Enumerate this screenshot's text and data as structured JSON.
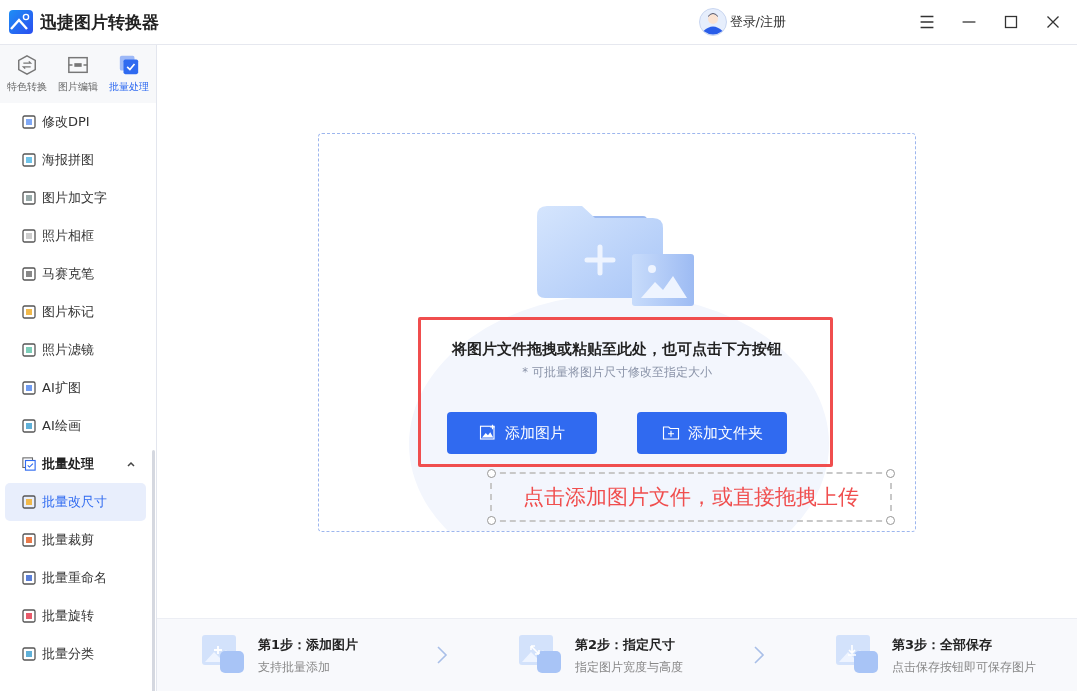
{
  "app": {
    "title": "迅捷图片转换器"
  },
  "user": {
    "label": "登录/注册"
  },
  "sidebar": {
    "tabs": [
      {
        "label": "特色转换",
        "selected": false,
        "kind": "convert"
      },
      {
        "label": "图片编辑",
        "selected": false,
        "kind": "edit"
      },
      {
        "label": "批量处理",
        "selected": true,
        "kind": "batch"
      }
    ],
    "items": [
      {
        "label": "修改DPI",
        "kind": "item",
        "selected": false
      },
      {
        "label": "海报拼图",
        "kind": "item",
        "selected": false
      },
      {
        "label": "图片加文字",
        "kind": "item",
        "selected": false
      },
      {
        "label": "照片相框",
        "kind": "item",
        "selected": false
      },
      {
        "label": "马赛克笔",
        "kind": "item",
        "selected": false
      },
      {
        "label": "图片标记",
        "kind": "item",
        "selected": false
      },
      {
        "label": "照片滤镜",
        "kind": "item",
        "selected": false
      },
      {
        "label": "AI扩图",
        "kind": "item",
        "selected": false
      },
      {
        "label": "AI绘画",
        "kind": "item",
        "selected": false
      },
      {
        "label": "批量处理",
        "kind": "group",
        "expanded": true,
        "children": [
          {
            "label": "批量改尺寸",
            "selected": true
          },
          {
            "label": "批量裁剪",
            "selected": false
          },
          {
            "label": "批量重命名",
            "selected": false
          },
          {
            "label": "批量旋转",
            "selected": false
          },
          {
            "label": "批量分类",
            "selected": false
          }
        ]
      }
    ]
  },
  "drop_zone": {
    "heading": "将图片文件拖拽或粘贴至此处，也可点击下方按钮",
    "hint": "* 可批量将图片尺寸修改至指定大小",
    "buttons": [
      {
        "label": "添加图片",
        "kind": "image"
      },
      {
        "label": "添加文件夹",
        "kind": "folder"
      }
    ]
  },
  "annotation": {
    "text": "点击添加图片文件，或直接拖拽上传"
  },
  "steps": [
    {
      "title": "第1步：添加图片",
      "description": "支持批量添加",
      "kind": "add"
    },
    {
      "title": "第2步：指定尺寸",
      "description": "指定图片宽度与高度",
      "kind": "resize"
    },
    {
      "title": "第3步：全部保存",
      "description": "点击保存按钮即可保存图片",
      "kind": "save"
    }
  ]
}
